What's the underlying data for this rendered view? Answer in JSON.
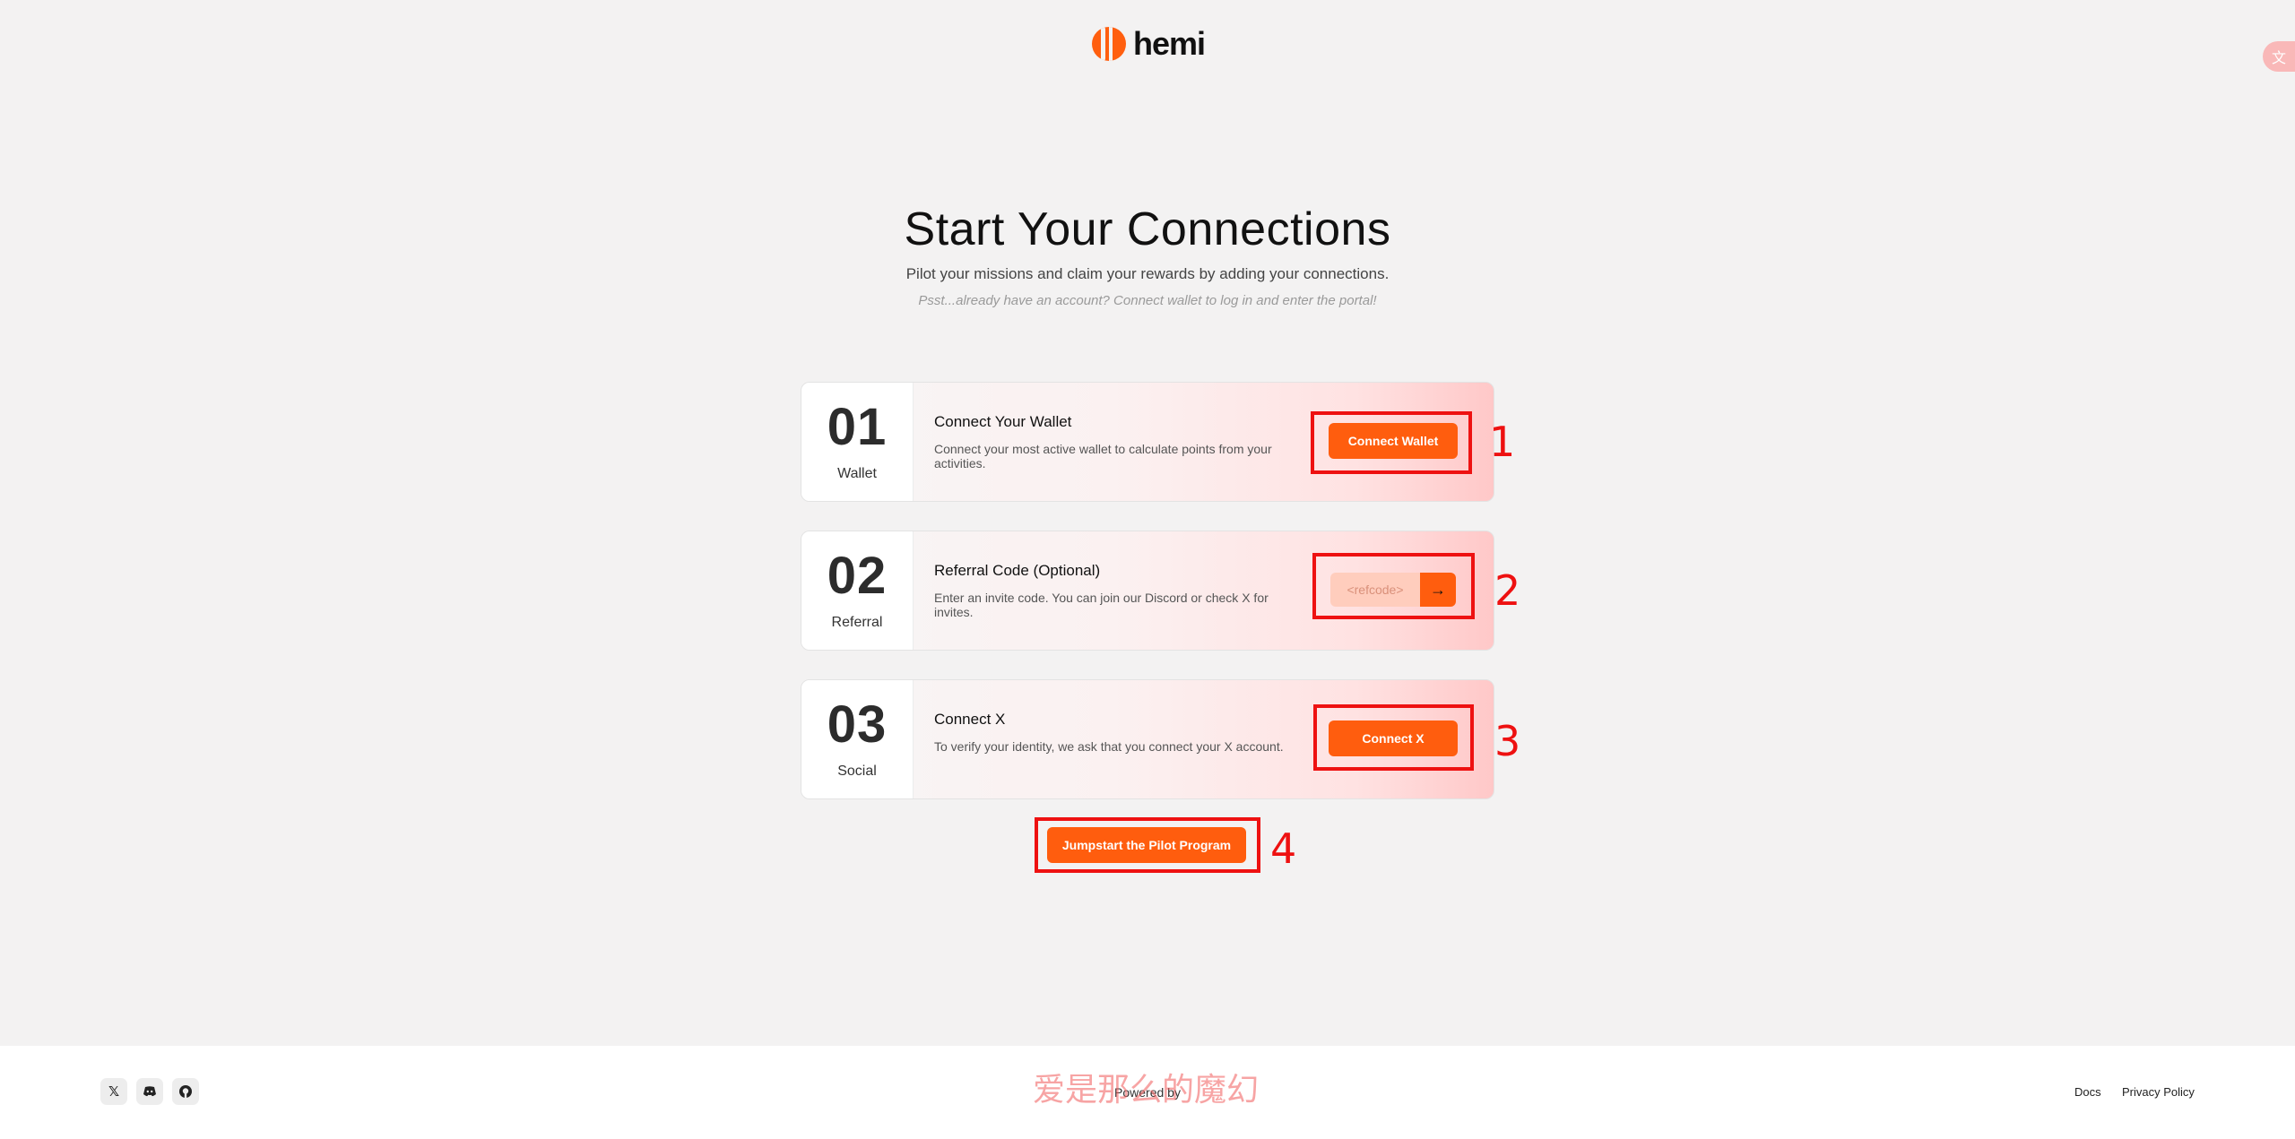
{
  "brand": {
    "name": "hemi"
  },
  "hero": {
    "title": "Start Your Connections",
    "subtitle": "Pilot your missions and claim your rewards by adding your connections.",
    "hint": "Psst...already have an account? Connect wallet to log in and enter the portal!"
  },
  "steps": [
    {
      "number": "01",
      "label": "Wallet",
      "title": "Connect Your Wallet",
      "description": "Connect your most active wallet to calculate points from your activities.",
      "button": "Connect Wallet",
      "marker": "1"
    },
    {
      "number": "02",
      "label": "Referral",
      "title": "Referral Code (Optional)",
      "description": "Enter an invite code. You can join our Discord or check X for invites.",
      "input_placeholder": "<refcode>",
      "input_value": "",
      "marker": "2"
    },
    {
      "number": "03",
      "label": "Social",
      "title": "Connect X",
      "description": "To verify your identity, we ask that you connect your X account.",
      "button": "Connect X",
      "marker": "3"
    }
  ],
  "cta": {
    "label": "Jumpstart the Pilot Program",
    "marker": "4"
  },
  "footer": {
    "social_icons": [
      "x-icon",
      "discord-icon",
      "github-icon"
    ],
    "powered_by": "Powered by",
    "watermark": "爱是那么的魔幻",
    "links": [
      "Docs",
      "Privacy Policy"
    ]
  },
  "colors": {
    "accent": "#ff5d0e",
    "annotation": "#ee1111",
    "background": "#f3f2f2"
  }
}
